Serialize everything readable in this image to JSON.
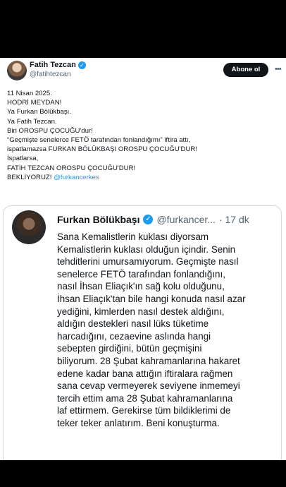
{
  "tweet": {
    "author_name": "Fatih Tezcan",
    "author_handle": "@fatihtezcan",
    "follow_label": "Abone ol",
    "more_icon": "more-dots-icon",
    "lines": [
      "11 Nisan 2025.",
      "HODRİ MEYDAN!",
      "Ya Furkan Bölükbaşı.",
      "Ya Fatih Tezcan.",
      "Biri OROSPU ÇOCUĞU'dur!",
      "“Geçmişte senelerce FETÖ tarafından fonlandığımı” iftira attı,",
      "ispatlamazsa  FURKAN BÖLÜKBAŞI OROSPU ÇOCUĞU'DUR!",
      "İspatlarsa,",
      "FATİH TEZCAN OROSPU ÇOCUĞU'DUR!"
    ],
    "last_line_text": "BEKLİYORUZ! ",
    "last_line_mention": "@furkancerkes"
  },
  "quote": {
    "author_name": "Furkan Bölükbaşı",
    "author_handle": "@furkancer...",
    "time": "· 17 dk",
    "lines": [
      "Sana Kemalistlerin kuklası diyorsam",
      "Kemalistlerin kuklası olduğun içindir. Senin",
      "tehditlerini umursamıyorum. Geçmişte nasıl",
      "senelerce FETÖ tarafından fonlandığını,",
      "nasıl İhsan Eliaçık'ın sağ kolu olduğunu,",
      "İhsan Eliaçık'tan bile hangi konuda nasıl azar",
      "yediğini, kimlerden nasıl destek aldığını,",
      "aldığın destekleri nasıl lüks tüketime",
      "harcadığını, cezaevine aslında hangi",
      "sebepten girdiğini, bütün geçmişini",
      "biliyorum. 28 Şubat kahramanlarına hakaret",
      "edene kadar bana attığın iftiralara rağmen",
      "sana cevap vermeyerek seviyene inmemeyi",
      "tercih ettim ama 28 Şubat kahramanlarına",
      "laf ettirmem. Gerekirse tüm bildiklerimi de",
      "teker teker anlatırım. Beni konuşturma."
    ]
  },
  "colors": {
    "accent": "#1d9bf0",
    "text": "#0f1419",
    "muted": "#536471",
    "border": "#cfd9de",
    "background": "#000000"
  }
}
